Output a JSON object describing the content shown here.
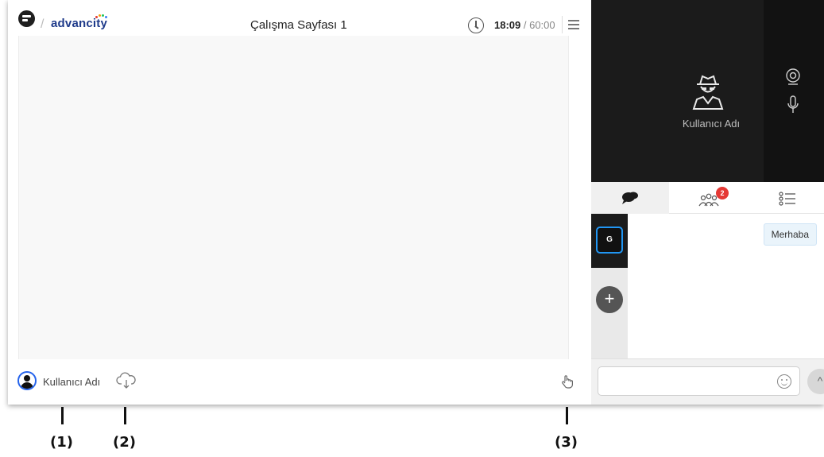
{
  "header": {
    "brand": "advancity",
    "page_title": "Çalışma Sayfası 1",
    "timer_current": "18:09",
    "timer_total": "/ 60:00"
  },
  "footer": {
    "user_name": "Kullanıcı Adı"
  },
  "video": {
    "participant_name": "Kullanıcı Adı"
  },
  "tabs": {
    "participants_badge": "2"
  },
  "chat": {
    "group_label": "G",
    "add_label": "+",
    "messages": [
      {
        "text": "Merhaba"
      }
    ],
    "input_value": "",
    "send_label": "^"
  },
  "annotations": {
    "label_1": "(1)",
    "label_2": "(2)",
    "label_3": "(3)"
  },
  "colors": {
    "brand": "#1e3a8a",
    "badge": "#e53935",
    "active_border": "#2196f3"
  }
}
